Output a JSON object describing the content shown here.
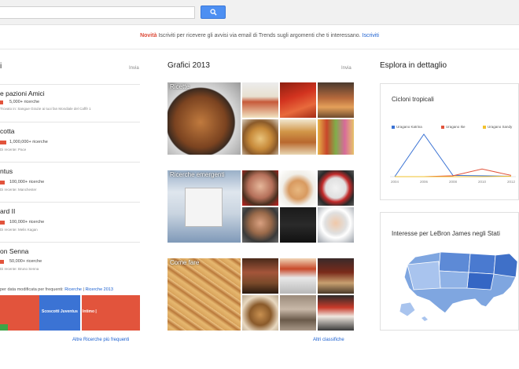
{
  "notice": {
    "new_label": "Novità",
    "text": "Iscriviti per ricevere gli avvisi via email di Trends sugli argomenti che ti interessano.",
    "link": "Iscriviti"
  },
  "columns": {
    "left_title": "i",
    "left_link": "Invia",
    "middle_title": "Grafici 2013",
    "middle_link": "Invia",
    "right_title": "Esplora in dettaglio"
  },
  "trends": [
    {
      "name": "e pazioni Amici",
      "count": "5,000+ ricerche",
      "sub": "Trovato in: Sangue Grazie ai tuoi fan Mondiale del Caffè 1"
    },
    {
      "name": "cotta",
      "count": "1,000,000+ ricerche",
      "sub": "Di recente: Pace"
    },
    {
      "name": "ntus",
      "count": "100,000+ ricerche",
      "sub": "Di recente: Manchester"
    },
    {
      "name": "ard II",
      "count": "100,000+ ricerche",
      "sub": "Di recente: Melis Kagan"
    },
    {
      "name": "on Senna",
      "count": "50,000+ ricerche",
      "sub": "Di recente: Bruno Senna"
    }
  ],
  "categories": {
    "label": "per data modificata per frequenti:",
    "link1": "Ricerche",
    "link2": "Ricerche 2013",
    "blocks": [
      {
        "label": "",
        "color": "#e2543c"
      },
      {
        "label": "Scoscotti Juventus",
        "color": "#3b73d4"
      },
      {
        "label": "Intimo |",
        "color": "#e2543c"
      }
    ]
  },
  "bottom_links": {
    "left": "Altre Ricerche più frequenti",
    "middle": "Altri classifiche"
  },
  "grids": [
    {
      "label": "Ricette"
    },
    {
      "label": "Ricerche emergenti"
    },
    {
      "label": "Come fare"
    }
  ],
  "cards": {
    "card1_title": "Cicloni tropicali",
    "legend": [
      {
        "label": "Uragano Katrina",
        "color": "#3b73d4"
      },
      {
        "label": "Uragano Ike",
        "color": "#e2543c"
      },
      {
        "label": "Uragano Sandy",
        "color": "#f2c12e"
      }
    ],
    "years": [
      "2004",
      "2006",
      "2008",
      "2010",
      "2012"
    ],
    "card2_title": "Interesse per LeBron James negli Stati"
  },
  "chart_data": {
    "type": "line",
    "title": "Cicloni tropicali",
    "x": [
      "2004",
      "2006",
      "2008",
      "2010",
      "2012"
    ],
    "series": [
      {
        "name": "Uragano Katrina",
        "values": [
          0,
          100,
          3,
          2,
          1
        ]
      },
      {
        "name": "Uragano Ike",
        "values": [
          0,
          0,
          2,
          18,
          3
        ]
      },
      {
        "name": "Uragano Sandy",
        "values": [
          0,
          0,
          0,
          0,
          1
        ]
      }
    ]
  }
}
